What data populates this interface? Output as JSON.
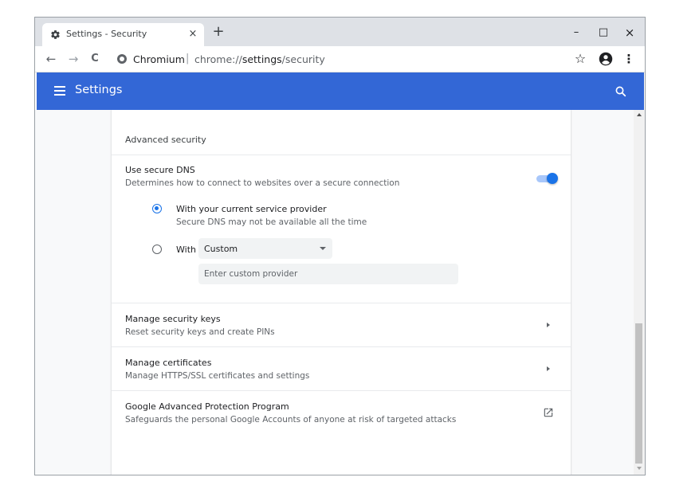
{
  "tab": {
    "title": "Settings - Security",
    "close": "×",
    "new_tab": "+"
  },
  "window_controls": {
    "minimize": "–",
    "maximize": "□",
    "close": "×"
  },
  "toolbar": {
    "back": "←",
    "forward": "→",
    "reload": "C",
    "origin": "Chromium",
    "separator": "|",
    "url_prefix": "chrome://",
    "url_host": "settings",
    "url_path": "/security",
    "bookmark": "☆",
    "menu": "⋮"
  },
  "header": {
    "title": "Settings"
  },
  "section": {
    "title": "Advanced security"
  },
  "secure_dns": {
    "title": "Use secure DNS",
    "subtitle": "Determines how to connect to websites over a secure connection",
    "enabled": true,
    "option_current": {
      "title": "With your current service provider",
      "subtitle": "Secure DNS may not be available all the time",
      "selected": true
    },
    "option_custom": {
      "label": "With",
      "selected": false
    },
    "select_value": "Custom",
    "custom_placeholder": "Enter custom provider"
  },
  "rows": [
    {
      "title": "Manage security keys",
      "subtitle": "Reset security keys and create PINs"
    },
    {
      "title": "Manage certificates",
      "subtitle": "Manage HTTPS/SSL certificates and settings"
    },
    {
      "title": "Google Advanced Protection Program",
      "subtitle": "Safeguards the personal Google Accounts of anyone at risk of targeted attacks"
    }
  ],
  "colors": {
    "accent": "#3367d6",
    "toggle": "#1a73e8",
    "tabstrip": "#dee1e6"
  },
  "icons": [
    "gear-icon",
    "back-icon",
    "forward-icon",
    "reload-icon",
    "site-info-icon",
    "star-icon",
    "account-icon",
    "menu-dots-icon",
    "hamburger-icon",
    "search-icon",
    "chevron-right-icon",
    "open-external-icon"
  ]
}
